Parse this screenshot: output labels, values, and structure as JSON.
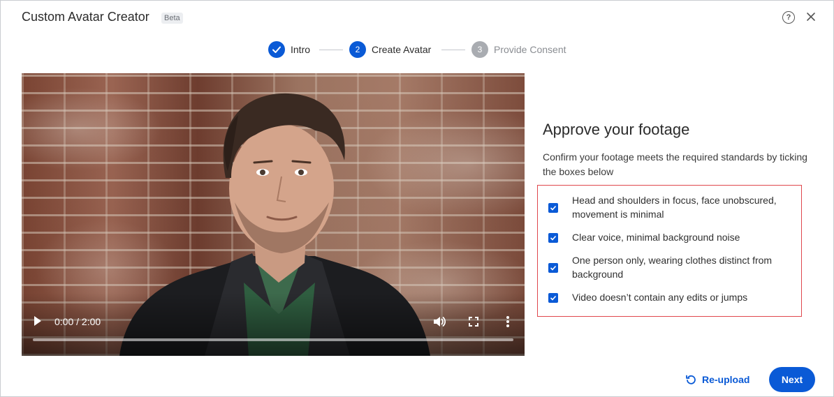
{
  "header": {
    "title": "Custom Avatar Creator",
    "badge": "Beta",
    "help_icon": "question-circle-icon",
    "close_icon": "close-icon"
  },
  "stepper": {
    "steps": [
      {
        "number": "1",
        "label": "Intro",
        "state": "completed"
      },
      {
        "number": "2",
        "label": "Create Avatar",
        "state": "active"
      },
      {
        "number": "3",
        "label": "Provide Consent",
        "state": "upcoming"
      }
    ]
  },
  "video": {
    "time": "0:00 / 2:00",
    "progress": 0,
    "icons": [
      "play-icon",
      "volume-icon",
      "fullscreen-icon",
      "more-vertical-icon"
    ]
  },
  "panel": {
    "heading": "Approve your footage",
    "description": "Confirm your footage meets the required standards by ticking the boxes below",
    "checklist": [
      {
        "label": "Head and shoulders in focus, face unobscured, movement is minimal",
        "checked": true
      },
      {
        "label": "Clear voice, minimal background noise",
        "checked": true
      },
      {
        "label": "One person only, wearing clothes distinct from background",
        "checked": true
      },
      {
        "label": "Video doesn’t contain any edits or jumps",
        "checked": true
      }
    ]
  },
  "footer": {
    "reupload_label": "Re-upload",
    "next_label": "Next"
  },
  "colors": {
    "accent": "#0a5ad6",
    "highlight_border": "#e0474c",
    "step_upcoming": "#a9acb1"
  }
}
